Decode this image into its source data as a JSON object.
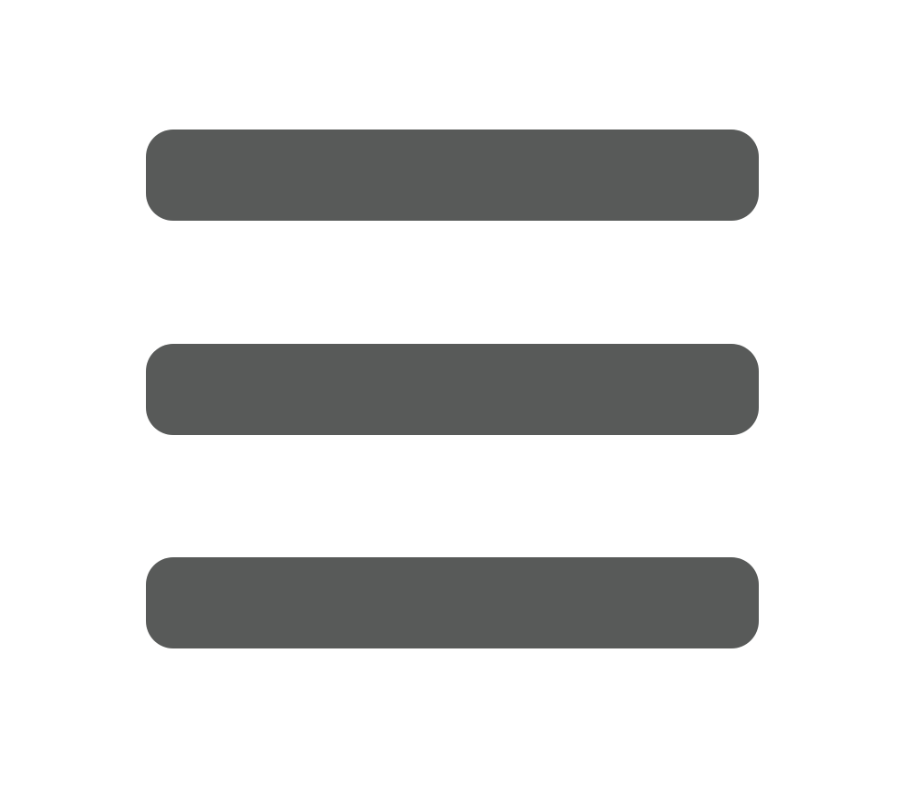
{
  "menu_button": {
    "icon": "hamburger-menu-icon",
    "bar_color": "#585a59",
    "background": "#ffffff"
  }
}
